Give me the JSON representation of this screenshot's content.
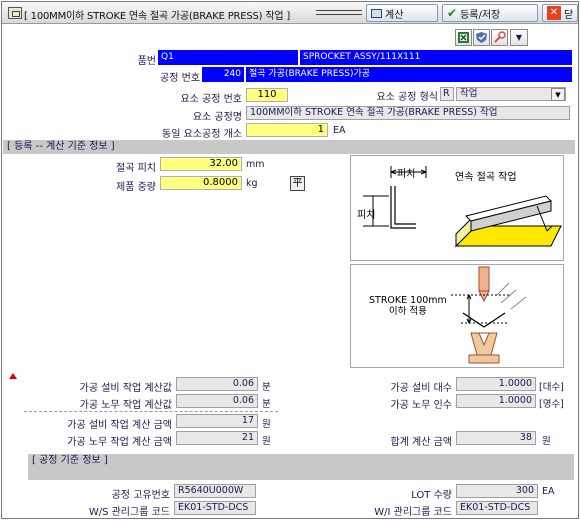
{
  "window": {
    "title": "[ 100MM이하 STROKE 연속 절곡 가공(BRAKE PRESS) 작업 ]",
    "calc_label": "계산",
    "save_label": "등록/저장",
    "close_label": "닫"
  },
  "toolbar": {
    "dropdown_glyph": "▼"
  },
  "header": {
    "part_no_label": "품번",
    "part_no": "Q1",
    "part_name": "SPROCKET ASSY/111X111",
    "process_no_label": "공정 번호",
    "process_no": "240",
    "process_name": "절곡 가공(BRAKE PRESS)가공",
    "elem_no_label": "요소 공정 번호",
    "elem_no": "110",
    "elem_type_label": "요소 공정 형식",
    "elem_type_code": "R",
    "elem_type_name": "작업",
    "elem_name_label": "요소 공정명",
    "elem_name": "100MM이하 STROKE 연속 절곡 가공(BRAKE PRESS) 작업",
    "same_count_label": "동일 요소공정 개소",
    "same_count": "1",
    "same_count_unit": "EA"
  },
  "calc_section": {
    "title": "[ 등록 -- 계산 기준 정보 ]",
    "pitch_label": "절곡 피치",
    "pitch_value": "32.00",
    "pitch_unit": "mm",
    "weight_label": "제품 중량",
    "weight_value": "0.8000",
    "weight_unit": "kg",
    "weight_icon_glyph": "平"
  },
  "diagrams": {
    "top": {
      "title": "연속 절곡 작업",
      "pitch_top": "피치",
      "pitch_side": "피치"
    },
    "bottom": {
      "caption_line1": "STROKE 100mm",
      "caption_line2": "이하 적용"
    }
  },
  "results": {
    "equip_time_label": "가공 설비 작업 계산값",
    "equip_time": "0.06",
    "equip_time_unit": "분",
    "labor_time_label": "가공 노무 작업 계산값",
    "labor_time": "0.06",
    "labor_time_unit": "분",
    "equip_count_label": "가공 설비 대수",
    "equip_count": "1.0000",
    "equip_count_unit": "[대수]",
    "labor_count_label": "가공 노무 인수",
    "labor_count": "1.0000",
    "labor_count_unit": "[명수]",
    "equip_amt_label": "가공 설비 작업 계산 금액",
    "equip_amt": "17",
    "equip_amt_unit": "원",
    "labor_amt_label": "가공 노무 작업 계산 금액",
    "labor_amt": "21",
    "labor_amt_unit": "원",
    "total_label": "합계 계산 금액",
    "total": "38",
    "total_unit": "원"
  },
  "process_section": {
    "title": "[ 공정 기준 정보 ]",
    "uid_label": "공정 고유번호",
    "uid": "R5640U000W",
    "lot_label": "LOT 수량",
    "lot": "300",
    "lot_unit": "EA",
    "ws_group_label": "W/S 관리그룹 코드",
    "ws_group": "EK01-STD-DCS",
    "wi_group_label": "W/I 관리그룹 코드",
    "wi_group": "EK01-STD-DCS"
  },
  "colors": {
    "accent_blue": "#0000ff",
    "input_yellow": "#ffff80",
    "section_gray": "#c8c8c8",
    "marker_red": "#e00000"
  }
}
